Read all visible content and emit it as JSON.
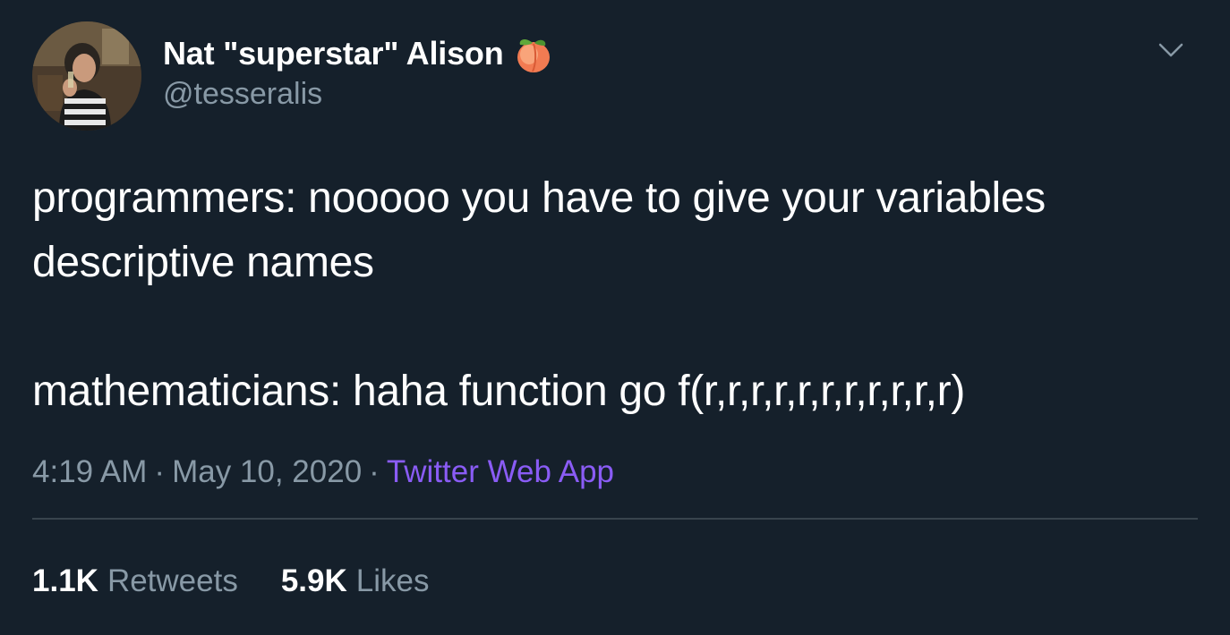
{
  "tweet": {
    "author": {
      "display_name": "Nat \"superstar\" Alison",
      "emoji_icon": "peach-icon",
      "handle": "@tesseralis"
    },
    "menu_icon": "chevron-down-icon",
    "body": {
      "line1": "programmers: nooooo you have to give your variables",
      "line2": "descriptive names",
      "line3": "mathematicians: haha function go f(r,r,r,r,r,r,r,r,r,r,r)"
    },
    "meta": {
      "time": "4:19 AM",
      "separator": "·",
      "date": "May 10, 2020",
      "source": "Twitter Web App"
    },
    "stats": {
      "retweets_count": "1.1K",
      "retweets_label": "Retweets",
      "likes_count": "5.9K",
      "likes_label": "Likes"
    }
  },
  "colors": {
    "background": "#15202b",
    "text_primary": "#ffffff",
    "text_secondary": "#8899a6",
    "source_link": "#8a5cf5",
    "divider": "#38444d"
  }
}
